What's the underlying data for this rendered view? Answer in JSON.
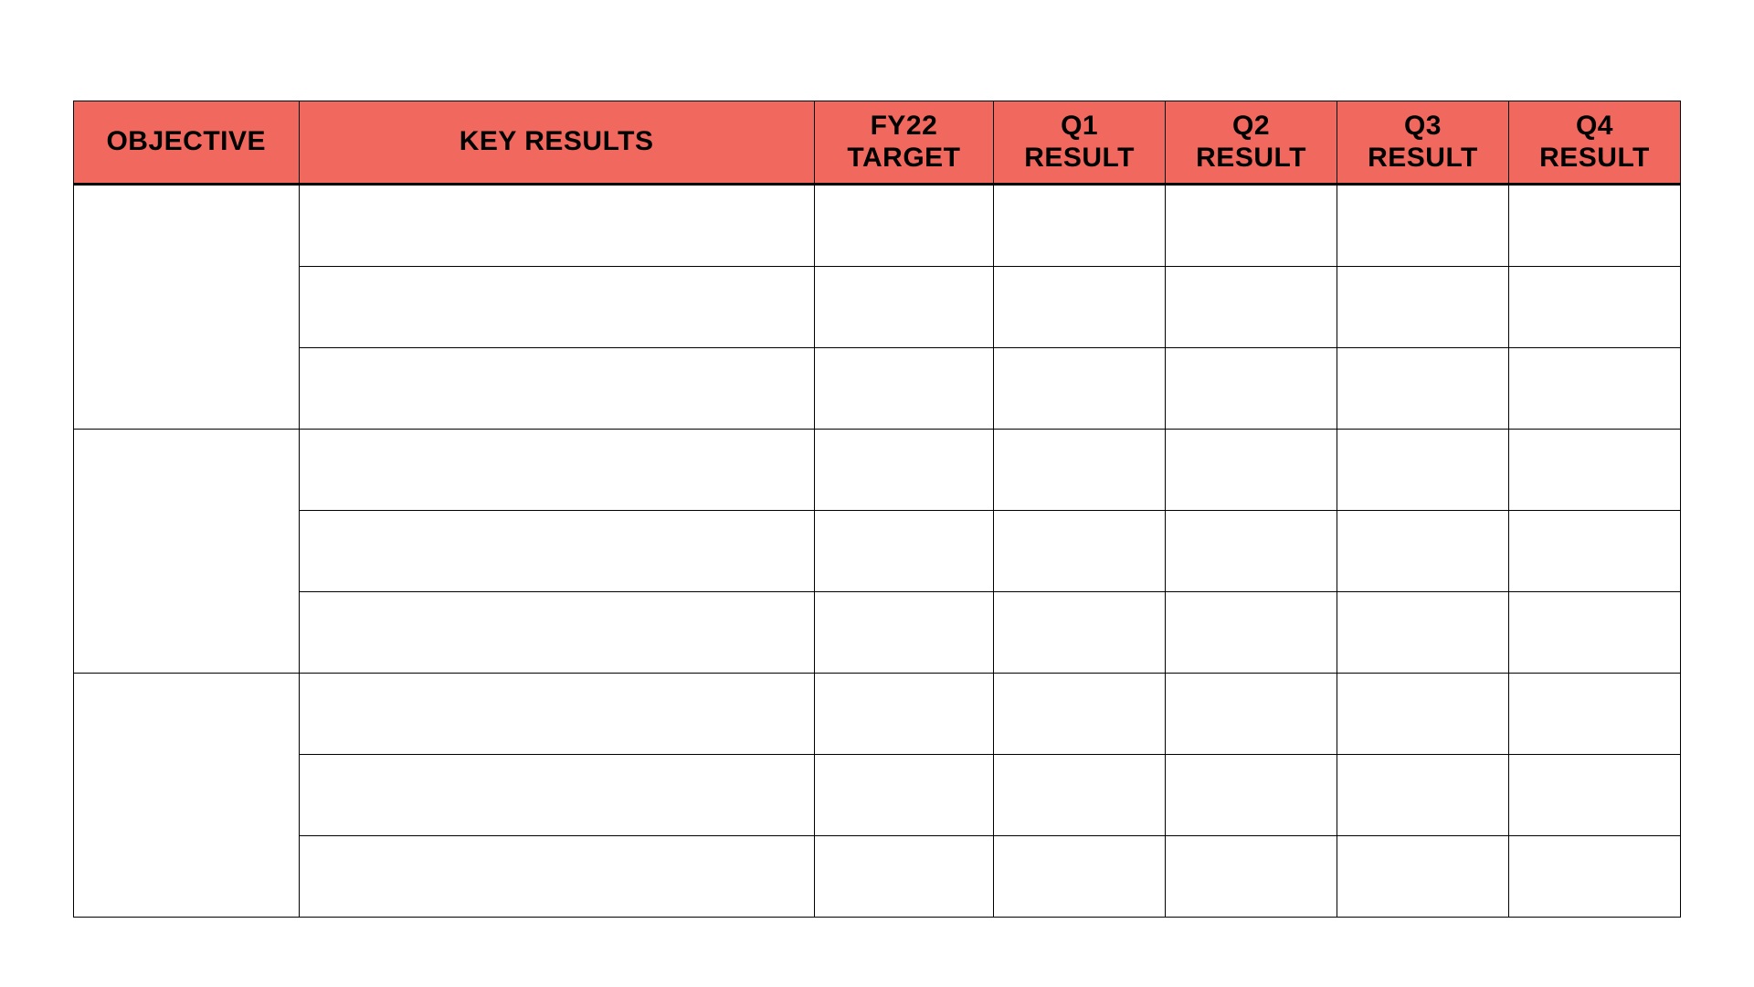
{
  "table": {
    "headers": {
      "objective": "OBJECTIVE",
      "keyresults": "KEY RESULTS",
      "target": "FY22\nTARGET",
      "q1": "Q1\nRESULT",
      "q2": "Q2\nRESULT",
      "q3": "Q3\nRESULT",
      "q4": "Q4\nRESULT"
    },
    "objectives": [
      {
        "objective": "",
        "rows": [
          {
            "key_result": "",
            "target": "",
            "q1": "",
            "q2": "",
            "q3": "",
            "q4": ""
          },
          {
            "key_result": "",
            "target": "",
            "q1": "",
            "q2": "",
            "q3": "",
            "q4": ""
          },
          {
            "key_result": "",
            "target": "",
            "q1": "",
            "q2": "",
            "q3": "",
            "q4": ""
          }
        ]
      },
      {
        "objective": "",
        "rows": [
          {
            "key_result": "",
            "target": "",
            "q1": "",
            "q2": "",
            "q3": "",
            "q4": ""
          },
          {
            "key_result": "",
            "target": "",
            "q1": "",
            "q2": "",
            "q3": "",
            "q4": ""
          },
          {
            "key_result": "",
            "target": "",
            "q1": "",
            "q2": "",
            "q3": "",
            "q4": ""
          }
        ]
      },
      {
        "objective": "",
        "rows": [
          {
            "key_result": "",
            "target": "",
            "q1": "",
            "q2": "",
            "q3": "",
            "q4": ""
          },
          {
            "key_result": "",
            "target": "",
            "q1": "",
            "q2": "",
            "q3": "",
            "q4": ""
          },
          {
            "key_result": "",
            "target": "",
            "q1": "",
            "q2": "",
            "q3": "",
            "q4": ""
          }
        ]
      }
    ]
  }
}
